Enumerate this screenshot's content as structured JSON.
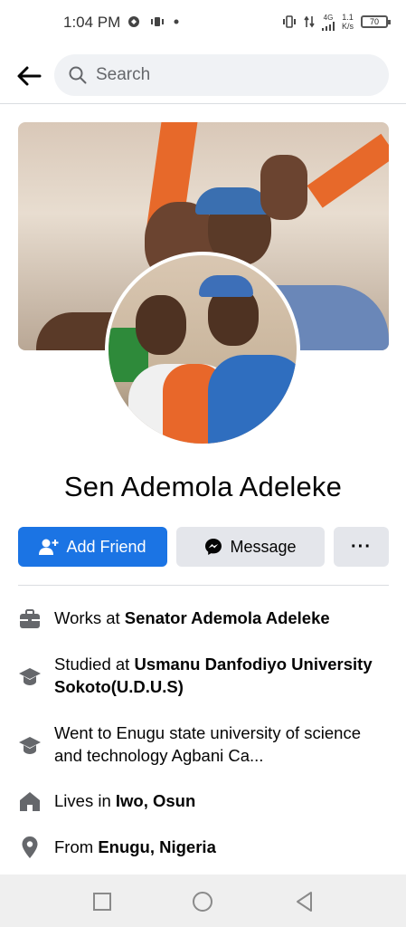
{
  "status": {
    "time": "1:04 PM",
    "network": "4G",
    "speed": "1.1",
    "speed_unit": "K/s",
    "battery": "70"
  },
  "search": {
    "placeholder": "Search"
  },
  "profile": {
    "name": "Sen Ademola Adeleke"
  },
  "actions": {
    "add_friend": "Add Friend",
    "message": "Message",
    "more": "···"
  },
  "info": {
    "work_prefix": "Works at ",
    "work_value": "Senator Ademola Adeleke",
    "study1_prefix": "Studied at ",
    "study1_value": "Usmanu Danfodiyo University Sokoto(U.D.U.S)",
    "study2_text": "Went to Enugu state university of science and technology Agbani Ca...",
    "lives_prefix": "Lives in ",
    "lives_value": "Iwo, Osun",
    "from_prefix": "From ",
    "from_value": "Enugu, Nigeria"
  },
  "icons": {
    "back": "arrow-left-icon",
    "search": "search-icon",
    "add_friend": "add-friend-icon",
    "message": "messenger-icon",
    "work": "briefcase-icon",
    "education": "graduation-cap-icon",
    "home": "home-icon",
    "location": "location-pin-icon"
  },
  "colors": {
    "primary": "#1b74e4",
    "secondary_bg": "#e4e6eb",
    "search_bg": "#f0f2f5",
    "icon_gray": "#65676b"
  }
}
